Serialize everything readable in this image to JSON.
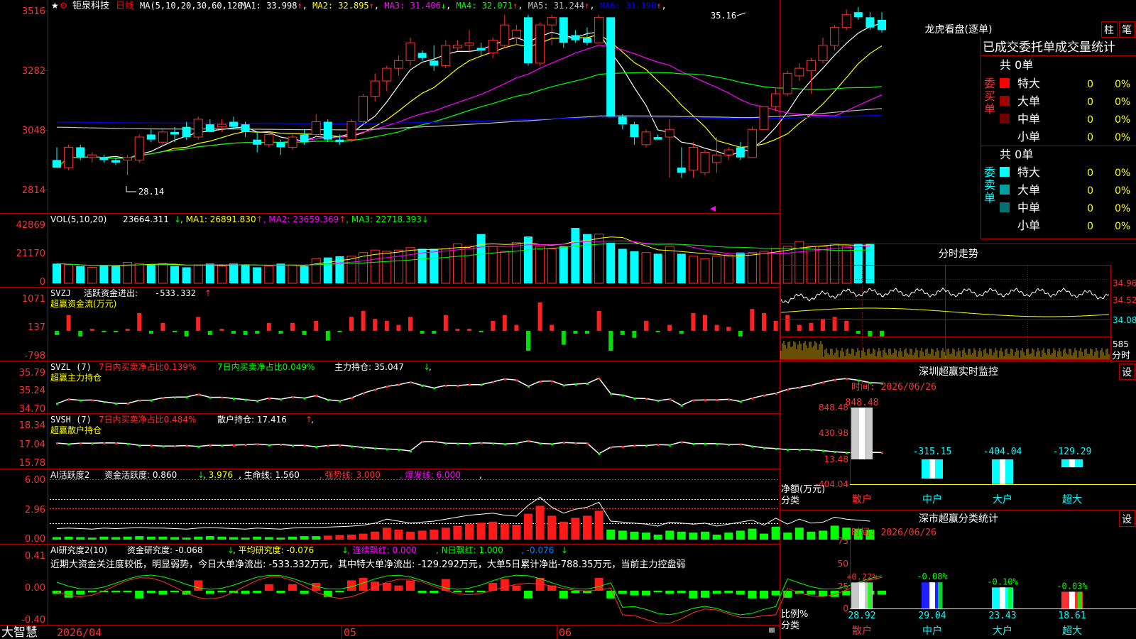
{
  "app": {
    "name": "大智慧",
    "icons": [
      "star-icon",
      "settings-icon"
    ],
    "date_labels": [
      "2026/04",
      "05",
      "06"
    ]
  },
  "stock": {
    "name": "钜泉科技",
    "period": "日线"
  },
  "price_axis": [
    "3516",
    "3282",
    "3048",
    "2814"
  ],
  "ma": {
    "spec": "MA(5,10,20,30,60,120)",
    "items": [
      {
        "label": "MA1:",
        "value": "33.998",
        "arrow": "↑",
        "color": "#ffffff"
      },
      {
        "label": "MA2:",
        "value": "32.895",
        "arrow": "↑",
        "color": "#ffff00"
      },
      {
        "label": "MA3:",
        "value": "31.406",
        "arrow": "↓",
        "color": "#ff00ff"
      },
      {
        "label": "MA4:",
        "value": "32.071",
        "arrow": "↑",
        "color": "#00ff00"
      },
      {
        "label": "MA5:",
        "value": "31.244",
        "arrow": "↑",
        "color": "#c0c0c0"
      },
      {
        "label": "MA6:",
        "value": "31.190",
        "arrow": "↑",
        "color": "#0000ff"
      }
    ]
  },
  "price_annotations": {
    "high": "35.16",
    "low": "28.14"
  },
  "vol": {
    "spec": "VOL(5,10,20)",
    "value": "23664.311",
    "arrow": "↓",
    "ma": [
      {
        "label": "MA1:",
        "value": "26891.830",
        "arrow": "↑",
        "color": "#ffff00"
      },
      {
        "label": "MA2:",
        "value": "23659.369",
        "arrow": "↑",
        "color": "#ff00ff"
      },
      {
        "label": "MA3:",
        "value": "22718.393",
        "arrow": "↓",
        "color": "#00ff00"
      }
    ],
    "axis": [
      "42869",
      "21170",
      "0"
    ]
  },
  "svzj": {
    "name": "SVZJ",
    "desc": "活跃资金进出:",
    "value": "-533.332",
    "arrow": "↑",
    "subtitle": "超赢资金流(万元)",
    "axis": [
      "1071",
      "137",
      "-798"
    ]
  },
  "svzl": {
    "name": "SVZL (7)",
    "t1": "7日内买卖净占比0.139%",
    "t2": "7日内买卖净占比0.049%",
    "t3": "主力持仓: 35.047",
    "arrow": "↓",
    "tail": ",",
    "subtitle": "超赢主力持仓",
    "axis": [
      "35.79",
      "35.24",
      "34.70"
    ]
  },
  "svsh": {
    "name": "SVSH (7)",
    "t1": "7日内买卖净占比0.484%",
    "t2": "散户持仓: 17.416",
    "arrow": "↑",
    "tail": ",",
    "subtitle": "超赢散户持仓",
    "axis": [
      "18.34",
      "17.04",
      "15.78"
    ]
  },
  "ai2": {
    "name": "AI活跃度2",
    "t1": "资金活跃度: 0.860",
    "a1": "↓",
    "t2": ", 3.976",
    "t3": ", 生命线: 1.560",
    "t4": ", 强势线: 3.000",
    "t5": ", 爆发线: 6.000",
    "t6": ",",
    "axis": [
      "6.00",
      "2.96",
      "0.00"
    ]
  },
  "ai_r": {
    "name": "AI研究度2(10)",
    "t1": "资金研究度: -0.068",
    "a1": "↓",
    "t2": ", 平均研究度: -0.076",
    "a2": "↓",
    "t3": ", 连续飘红: 0.000",
    "t4": ", N日飘红: 1.000",
    "t5": ", -0.076",
    "a5": "↓",
    "comment": "近期大资金关注度较低，明显弱势，今日大单净流出: -533.332万元，其中特大单净流出: -129.292万元，大单5日累计净出-788.35万元，当前主力控盘弱",
    "axis": [
      "0.41",
      "0.00",
      "-0.40"
    ]
  },
  "right": {
    "lhb_title": "龙虎看盘(逐单)",
    "btn_zhu": "柱",
    "btn_bi": "笔",
    "stat_header": "已成交委托单成交量统计",
    "buy_label": "委买单",
    "sell_label": "委卖单",
    "buy_total": "共 0单",
    "sell_total": "共 0单",
    "buy_rows": [
      {
        "label": "特大",
        "count": "0",
        "pct": "0%",
        "color": "#ff0000"
      },
      {
        "label": "大单",
        "count": "0",
        "pct": "0%",
        "color": "#a00000"
      },
      {
        "label": "中单",
        "count": "0",
        "pct": "0%",
        "color": "#700000"
      },
      {
        "label": "小单",
        "count": "0",
        "pct": "0%",
        "color": "#000000"
      }
    ],
    "sell_rows": [
      {
        "label": "特大",
        "count": "0",
        "pct": "0%",
        "color": "#00ffff"
      },
      {
        "label": "大单",
        "count": "0",
        "pct": "0%",
        "color": "#00a0a0"
      },
      {
        "label": "中单",
        "count": "0",
        "pct": "0%",
        "color": "#007070"
      },
      {
        "label": "小单",
        "count": "0",
        "pct": "0%",
        "color": "#000000"
      }
    ],
    "fs_title": "分时走势",
    "fs_axis": [
      "34.96",
      "34.52",
      "34.08"
    ],
    "fs_vol": "585",
    "fs_vol_unit": "分时",
    "sz_title": "深圳超赢实时监控",
    "sz_btn": "设",
    "sz_time": "时间: 2026/06/26",
    "sz_axis": [
      "848.48",
      "430.98",
      "13.48",
      "-404.04"
    ],
    "sz_ylabel": "净额(万元)",
    "sz_xlabel": "分类",
    "sz_cats": [
      "散户",
      "中户",
      "大户",
      "超大"
    ],
    "sz_values": [
      848.48,
      -315.15,
      -404.04,
      -129.29
    ],
    "sz_labels": [
      "848.48",
      "-315.15",
      "-404.04",
      "-129.29"
    ],
    "sc_title": "深市超赢分类统计",
    "sc_btn": "设",
    "sc_time": "时间: 2026/06/26",
    "sc_axis": [
      "75",
      "50",
      "25",
      "0"
    ],
    "sc_ylabel": "比例%",
    "sc_xlabel": "分类",
    "sc_cats": [
      "散户",
      "中户",
      "大户",
      "超大"
    ],
    "sc_values": [
      28.92,
      29.04,
      23.43,
      18.61
    ],
    "sc_changes": [
      "+0.22%",
      "-0.08%",
      "-0.10%",
      "-0.03%"
    ]
  },
  "chart_data": {
    "type": "candlestick",
    "title": "钜泉科技 日线",
    "candles": [
      {
        "o": 29.3,
        "h": 29.8,
        "l": 29.0,
        "c": 29.0
      },
      {
        "o": 29.0,
        "h": 29.9,
        "l": 28.9,
        "c": 29.8
      },
      {
        "o": 29.8,
        "h": 29.9,
        "l": 29.3,
        "c": 29.4
      },
      {
        "o": 29.4,
        "h": 29.6,
        "l": 29.2,
        "c": 29.5
      },
      {
        "o": 29.4,
        "h": 29.5,
        "l": 29.2,
        "c": 29.3
      },
      {
        "o": 29.3,
        "h": 29.4,
        "l": 29.1,
        "c": 29.2
      },
      {
        "o": 29.3,
        "h": 29.5,
        "l": 28.7,
        "c": 29.4
      },
      {
        "o": 29.3,
        "h": 30.3,
        "l": 29.2,
        "c": 30.2
      },
      {
        "o": 30.3,
        "h": 30.5,
        "l": 30.0,
        "c": 30.1
      },
      {
        "o": 30.0,
        "h": 30.5,
        "l": 29.9,
        "c": 30.4
      },
      {
        "o": 30.4,
        "h": 30.6,
        "l": 30.0,
        "c": 30.3
      },
      {
        "o": 30.6,
        "h": 30.8,
        "l": 30.1,
        "c": 30.2
      },
      {
        "o": 30.2,
        "h": 31.0,
        "l": 30.1,
        "c": 30.9
      },
      {
        "o": 30.7,
        "h": 30.9,
        "l": 30.4,
        "c": 30.4
      },
      {
        "o": 30.6,
        "h": 30.9,
        "l": 30.4,
        "c": 30.7
      },
      {
        "o": 30.8,
        "h": 31.0,
        "l": 30.5,
        "c": 30.6
      },
      {
        "o": 30.7,
        "h": 30.8,
        "l": 30.2,
        "c": 30.4
      },
      {
        "o": 30.1,
        "h": 30.4,
        "l": 29.6,
        "c": 29.9
      },
      {
        "o": 29.9,
        "h": 30.4,
        "l": 29.8,
        "c": 30.3
      },
      {
        "o": 30.0,
        "h": 30.1,
        "l": 29.5,
        "c": 29.8
      },
      {
        "o": 29.8,
        "h": 30.3,
        "l": 29.7,
        "c": 30.2
      },
      {
        "o": 30.3,
        "h": 30.5,
        "l": 29.9,
        "c": 30.0
      },
      {
        "o": 30.3,
        "h": 31.1,
        "l": 30.2,
        "c": 30.8
      },
      {
        "o": 30.8,
        "h": 30.9,
        "l": 30.0,
        "c": 30.1
      },
      {
        "o": 30.1,
        "h": 30.3,
        "l": 29.9,
        "c": 30.0
      },
      {
        "o": 30.1,
        "h": 30.9,
        "l": 30.0,
        "c": 30.8
      },
      {
        "o": 30.8,
        "h": 31.9,
        "l": 30.7,
        "c": 31.8
      },
      {
        "o": 31.8,
        "h": 32.7,
        "l": 31.6,
        "c": 32.4
      },
      {
        "o": 32.4,
        "h": 33.0,
        "l": 32.0,
        "c": 32.9
      },
      {
        "o": 32.9,
        "h": 33.4,
        "l": 32.6,
        "c": 33.2
      },
      {
        "o": 33.2,
        "h": 34.1,
        "l": 33.0,
        "c": 33.9
      },
      {
        "o": 33.5,
        "h": 33.6,
        "l": 33.2,
        "c": 33.3
      },
      {
        "o": 33.2,
        "h": 33.8,
        "l": 32.8,
        "c": 33.0
      },
      {
        "o": 33.0,
        "h": 34.0,
        "l": 32.9,
        "c": 33.8
      },
      {
        "o": 33.7,
        "h": 34.0,
        "l": 33.6,
        "c": 33.8
      },
      {
        "o": 33.8,
        "h": 34.4,
        "l": 33.5,
        "c": 33.9
      },
      {
        "o": 33.7,
        "h": 33.9,
        "l": 33.4,
        "c": 33.6
      },
      {
        "o": 33.5,
        "h": 34.1,
        "l": 33.3,
        "c": 34.0
      },
      {
        "o": 33.8,
        "h": 35.0,
        "l": 33.7,
        "c": 34.6
      },
      {
        "o": 34.1,
        "h": 34.6,
        "l": 33.8,
        "c": 34.4
      },
      {
        "o": 34.9,
        "h": 35.0,
        "l": 33.0,
        "c": 33.1
      },
      {
        "o": 33.1,
        "h": 34.7,
        "l": 33.0,
        "c": 34.6
      },
      {
        "o": 34.6,
        "h": 35.0,
        "l": 33.8,
        "c": 34.9
      },
      {
        "o": 34.9,
        "h": 34.9,
        "l": 33.7,
        "c": 33.9
      },
      {
        "o": 34.2,
        "h": 34.4,
        "l": 33.9,
        "c": 34.0
      },
      {
        "o": 34.1,
        "h": 34.5,
        "l": 33.8,
        "c": 33.9
      },
      {
        "o": 33.9,
        "h": 35.0,
        "l": 33.9,
        "c": 34.9
      },
      {
        "o": 34.9,
        "h": 34.9,
        "l": 31.0,
        "c": 31.0
      },
      {
        "o": 31.0,
        "h": 31.1,
        "l": 30.5,
        "c": 30.7
      },
      {
        "o": 30.7,
        "h": 30.8,
        "l": 29.9,
        "c": 30.2
      },
      {
        "o": 29.9,
        "h": 30.5,
        "l": 29.8,
        "c": 30.4
      },
      {
        "o": 30.2,
        "h": 30.3,
        "l": 30.1,
        "c": 30.1
      },
      {
        "o": 30.2,
        "h": 30.9,
        "l": 28.6,
        "c": 30.5
      },
      {
        "o": 29.0,
        "h": 29.8,
        "l": 28.6,
        "c": 28.8
      },
      {
        "o": 28.9,
        "h": 30.0,
        "l": 28.6,
        "c": 29.8
      },
      {
        "o": 28.8,
        "h": 29.7,
        "l": 28.7,
        "c": 29.6
      },
      {
        "o": 29.2,
        "h": 30.2,
        "l": 28.8,
        "c": 29.5
      },
      {
        "o": 29.5,
        "h": 29.8,
        "l": 29.3,
        "c": 29.7
      },
      {
        "o": 29.8,
        "h": 30.0,
        "l": 29.3,
        "c": 29.4
      },
      {
        "o": 29.4,
        "h": 30.6,
        "l": 29.4,
        "c": 30.5
      },
      {
        "o": 30.5,
        "h": 31.4,
        "l": 30.5,
        "c": 31.4
      },
      {
        "o": 31.4,
        "h": 32.1,
        "l": 31.2,
        "c": 31.9
      },
      {
        "o": 31.9,
        "h": 32.8,
        "l": 31.8,
        "c": 32.7
      },
      {
        "o": 32.6,
        "h": 33.1,
        "l": 32.4,
        "c": 32.9
      },
      {
        "o": 32.8,
        "h": 33.3,
        "l": 31.9,
        "c": 33.2
      },
      {
        "o": 33.2,
        "h": 34.1,
        "l": 33.1,
        "c": 33.8
      },
      {
        "o": 33.8,
        "h": 34.6,
        "l": 33.6,
        "c": 34.5
      },
      {
        "o": 34.5,
        "h": 35.2,
        "l": 34.4,
        "c": 35.0
      },
      {
        "o": 35.1,
        "h": 35.3,
        "l": 34.8,
        "c": 34.9
      },
      {
        "o": 34.9,
        "h": 35.1,
        "l": 34.4,
        "c": 34.5
      },
      {
        "o": 34.8,
        "h": 35.1,
        "l": 34.3,
        "c": 34.4
      }
    ],
    "volume": [
      16,
      15,
      14,
      13,
      15,
      14,
      17,
      16,
      15,
      16,
      14,
      13,
      15,
      16,
      14,
      16,
      15,
      13,
      14,
      16,
      15,
      14,
      20,
      21,
      22,
      22,
      25,
      27,
      26,
      27,
      29,
      28,
      28,
      28,
      32,
      30,
      40,
      30,
      26,
      33,
      38,
      30,
      28,
      30,
      45,
      40,
      40,
      33,
      28,
      26,
      25,
      24,
      30,
      24,
      22,
      20,
      22,
      23,
      25,
      25,
      26,
      28,
      30,
      34,
      30,
      30,
      32,
      30,
      32,
      32
    ],
    "ai2": [
      0.25,
      0.3,
      0.25,
      0.2,
      0.3,
      0.25,
      0.3,
      0.35,
      0.3,
      0.3,
      0.25,
      0.2,
      0.3,
      0.35,
      0.3,
      0.25,
      0.2,
      0.3,
      0.25,
      0.2,
      0.3,
      0.35,
      0.35,
      0.4,
      0.45,
      0.5,
      0.6,
      0.8,
      1.2,
      1.0,
      0.8,
      0.9,
      1.0,
      1.2,
      1.4,
      1.6,
      1.7,
      1.8,
      1.6,
      1.5,
      2.6,
      3.4,
      2.4,
      1.8,
      2.2,
      2.4,
      2.9,
      1.0,
      0.9,
      0.8,
      0.7,
      0.5,
      0.9,
      0.8,
      0.7,
      0.8,
      0.5,
      0.7,
      0.9,
      1.1,
      0.6,
      1.3,
      0.7,
      1.2,
      0.8,
      0.9,
      1.4,
      1.2,
      1.1,
      1.0
    ],
    "ai2_colors": "GGGGGGGGGGGGGGGGGGGGGGGRRRRRRRRRRRRRRRRRRRRRRRRGGGGGGGGGGGGGGGGGGGGGGG"
  }
}
